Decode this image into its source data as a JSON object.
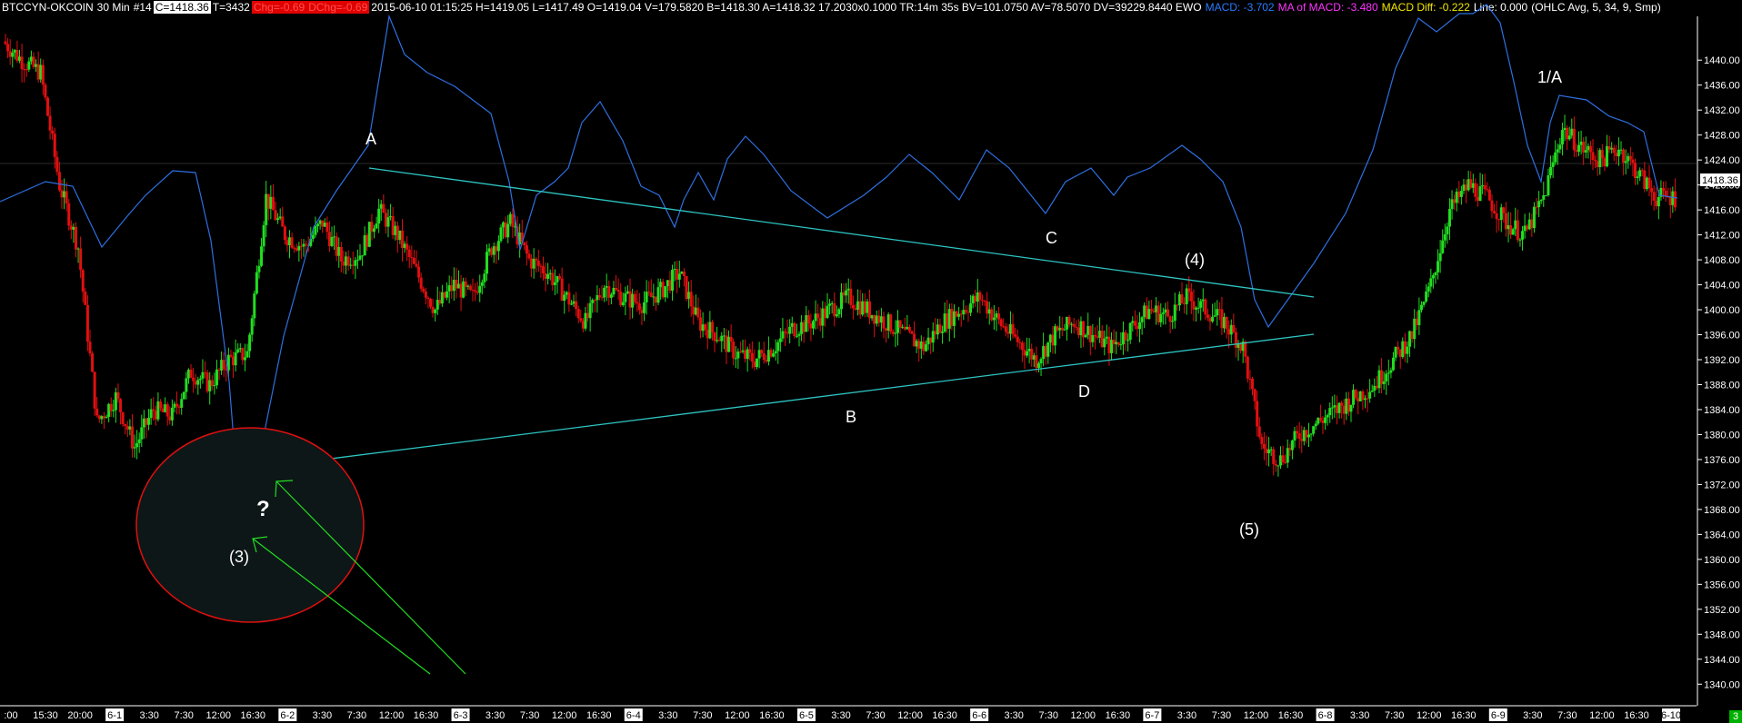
{
  "header": {
    "symbol": "BTCCYN-OKCOIN",
    "interval": "30 Min",
    "bar_no": "#14",
    "close": "C=1418.36",
    "tick": "T=3432",
    "chg": "Chg=-0.69",
    "dchg": "DChg=-0.69",
    "stats": "2015-06-10 01:15:25 H=1419.05 L=1417.49 O=1419.04 V=179.5820 B=1418.30 A=1418.32 17.2030x0.1000 TR:14m 35s BV=101.0750 AV=78.5070 DV=39229.8440 EWO",
    "macd": "MACD: -3.702",
    "ma_macd": "MA of MACD: -3.480",
    "macd_diff": "MACD Diff: -0.222",
    "line": "Line: 0.000",
    "params": "(OHLC Avg, 5, 34, 9, Smp)"
  },
  "last_price_label": "1418.36",
  "corner_badge": "3",
  "chart_data": {
    "type": "candlestick",
    "y_axis": {
      "side": "right",
      "ylim": [
        1338,
        1446
      ],
      "ticks": [
        "1440.00",
        "1436.00",
        "1432.00",
        "1428.00",
        "1424.00",
        "1420.00",
        "1416.00",
        "1412.00",
        "1408.00",
        "1404.00",
        "1400.00",
        "1396.00",
        "1392.00",
        "1388.00",
        "1384.00",
        "1380.00",
        "1376.00",
        "1372.00",
        "1368.00",
        "1364.00",
        "1360.00",
        "1356.00",
        "1352.00",
        "1348.00",
        "1344.00",
        "1340.00"
      ],
      "tick_values": [
        1440,
        1436,
        1432,
        1428,
        1424,
        1420,
        1416,
        1412,
        1408,
        1404,
        1400,
        1396,
        1392,
        1388,
        1384,
        1380,
        1376,
        1372,
        1368,
        1364,
        1360,
        1356,
        1352,
        1348,
        1344,
        1340
      ]
    },
    "x_axis": {
      "ticks": [
        {
          "label": ":00",
          "hl": false
        },
        {
          "label": "15:30",
          "hl": false
        },
        {
          "label": "20:00",
          "hl": false
        },
        {
          "label": "6-1",
          "hl": true
        },
        {
          "label": "3:30",
          "hl": false
        },
        {
          "label": "7:30",
          "hl": false
        },
        {
          "label": "12:00",
          "hl": false
        },
        {
          "label": "16:30",
          "hl": false
        },
        {
          "label": "6-2",
          "hl": true
        },
        {
          "label": "3:30",
          "hl": false
        },
        {
          "label": "7:30",
          "hl": false
        },
        {
          "label": "12:00",
          "hl": false
        },
        {
          "label": "16:30",
          "hl": false
        },
        {
          "label": "6-3",
          "hl": true
        },
        {
          "label": "3:30",
          "hl": false
        },
        {
          "label": "7:30",
          "hl": false
        },
        {
          "label": "12:00",
          "hl": false
        },
        {
          "label": "16:30",
          "hl": false
        },
        {
          "label": "6-4",
          "hl": true
        },
        {
          "label": "3:30",
          "hl": false
        },
        {
          "label": "7:30",
          "hl": false
        },
        {
          "label": "12:00",
          "hl": false
        },
        {
          "label": "16:30",
          "hl": false
        },
        {
          "label": "6-5",
          "hl": true
        },
        {
          "label": "3:30",
          "hl": false
        },
        {
          "label": "7:30",
          "hl": false
        },
        {
          "label": "12:00",
          "hl": false
        },
        {
          "label": "16:30",
          "hl": false
        },
        {
          "label": "6-6",
          "hl": true
        },
        {
          "label": "3:30",
          "hl": false
        },
        {
          "label": "7:30",
          "hl": false
        },
        {
          "label": "12:00",
          "hl": false
        },
        {
          "label": "16:30",
          "hl": false
        },
        {
          "label": "6-7",
          "hl": true
        },
        {
          "label": "3:30",
          "hl": false
        },
        {
          "label": "7:30",
          "hl": false
        },
        {
          "label": "12:00",
          "hl": false
        },
        {
          "label": "16:30",
          "hl": false
        },
        {
          "label": "6-8",
          "hl": true
        },
        {
          "label": "3:30",
          "hl": false
        },
        {
          "label": "7:30",
          "hl": false
        },
        {
          "label": "12:00",
          "hl": false
        },
        {
          "label": "16:30",
          "hl": false
        },
        {
          "label": "6-9",
          "hl": true
        },
        {
          "label": "3:30",
          "hl": false
        },
        {
          "label": "7:30",
          "hl": false
        },
        {
          "label": "12:00",
          "hl": false
        },
        {
          "label": "16:30",
          "hl": false
        },
        {
          "label": "6-10",
          "hl": true
        }
      ]
    },
    "price_path": [
      1443,
      1440,
      1438,
      1420,
      1410,
      1382,
      1386,
      1378,
      1384,
      1383,
      1390,
      1388,
      1392,
      1393,
      1418,
      1412,
      1410,
      1414,
      1408,
      1409,
      1416,
      1412,
      1406,
      1400,
      1404,
      1402,
      1410,
      1414,
      1408,
      1406,
      1402,
      1398,
      1404,
      1402,
      1401,
      1403,
      1406,
      1398,
      1396,
      1393,
      1392,
      1394,
      1397,
      1398,
      1400,
      1402,
      1400,
      1398,
      1396,
      1394,
      1398,
      1400,
      1402,
      1398,
      1395,
      1392,
      1396,
      1398,
      1396,
      1394,
      1397,
      1400,
      1399,
      1402,
      1400,
      1398,
      1394,
      1378,
      1376,
      1380,
      1382,
      1384,
      1386,
      1388,
      1392,
      1396,
      1404,
      1416,
      1420,
      1418,
      1414,
      1412,
      1418,
      1429,
      1426,
      1424,
      1426,
      1422,
      1418,
      1418
    ],
    "candles_per_segment": 8,
    "trendline_color": "#2ec4c0",
    "ewo_color": "#2e6fe0",
    "annotations": [
      "A",
      "B",
      "C",
      "D",
      "(3)",
      "(4)",
      "(5)",
      "1/A",
      "?"
    ]
  }
}
